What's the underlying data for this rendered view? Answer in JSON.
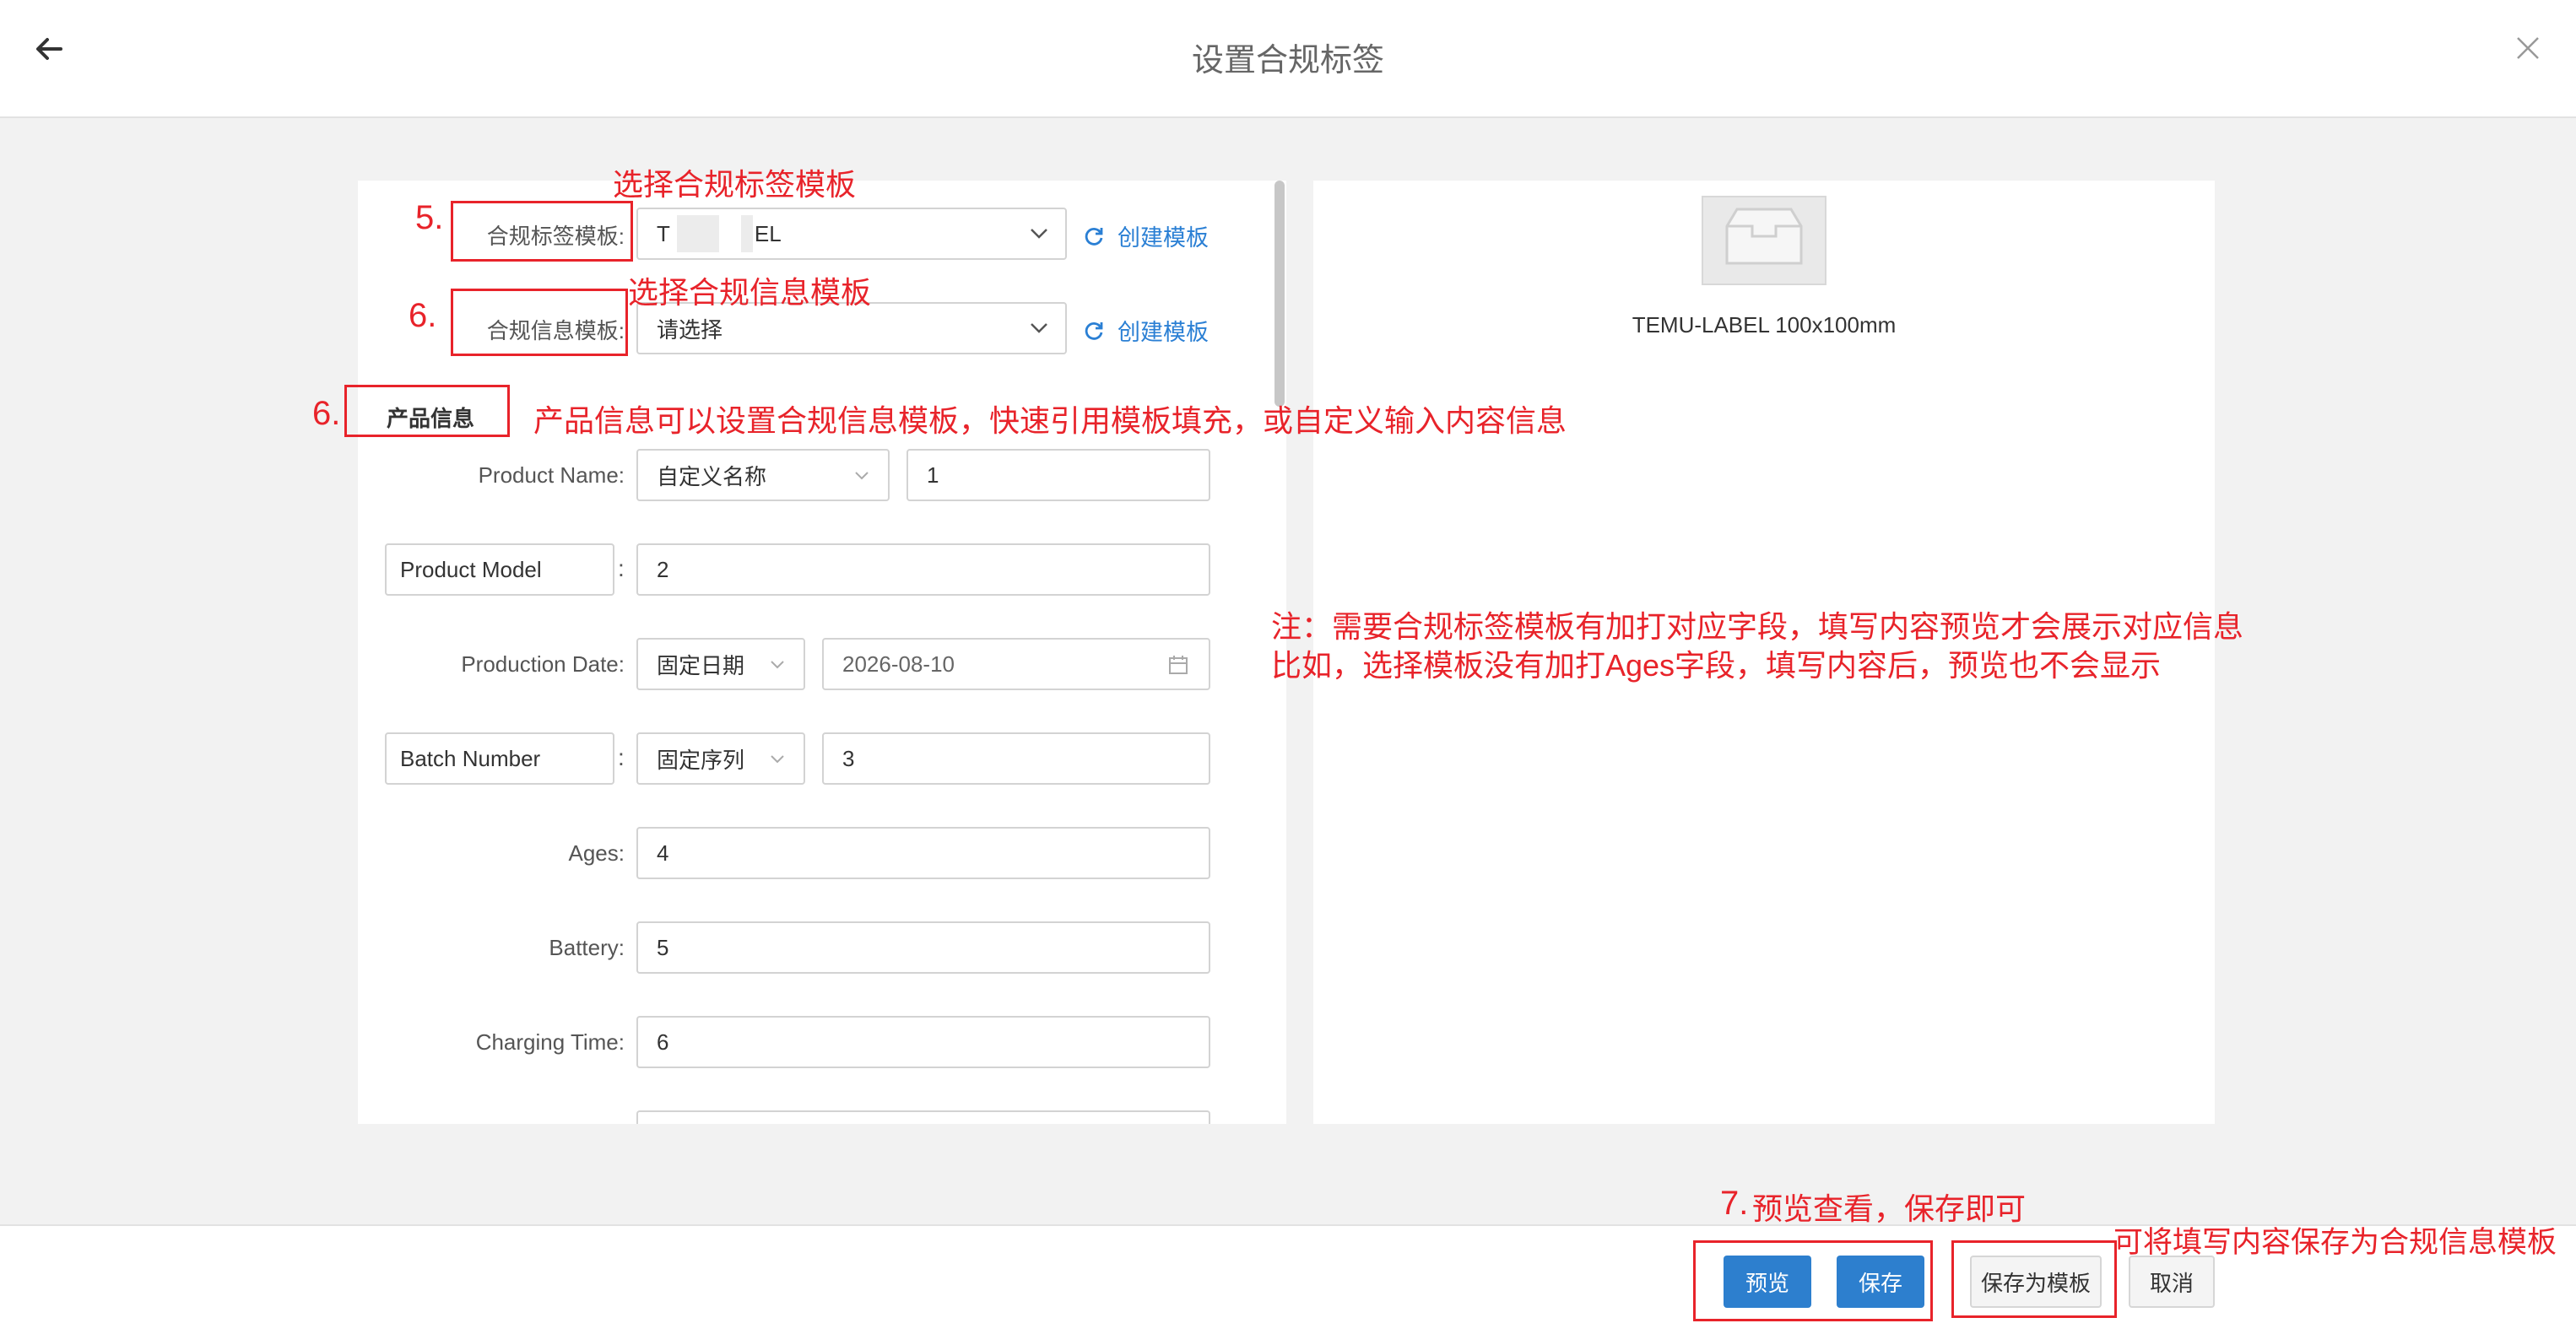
{
  "header": {
    "title": "设置合规标签"
  },
  "form": {
    "template_label": "合规标签模板:",
    "template_value_prefix": "T",
    "template_value_suffix": "EL",
    "info_template_label": "合规信息模板:",
    "info_template_placeholder": "请选择",
    "create_link": "创建模板",
    "section_tab": "产品信息",
    "fields": {
      "product_name": {
        "label": "Product Name:",
        "type": "自定义名称",
        "value": "1"
      },
      "product_model": {
        "key": "Product Model",
        "value": "2"
      },
      "production_date": {
        "label": "Production Date:",
        "type": "固定日期",
        "value": "2026-08-10"
      },
      "batch_number": {
        "key": "Batch Number",
        "type": "固定序列",
        "value": "3"
      },
      "ages": {
        "label": "Ages:",
        "value": "4"
      },
      "battery": {
        "label": "Battery:",
        "value": "5"
      },
      "charging_time": {
        "label": "Charging Time:",
        "value": "6"
      }
    }
  },
  "preview": {
    "caption": "TEMU-LABEL 100x100mm"
  },
  "footer": {
    "preview_btn": "预览",
    "save_btn": "保存",
    "save_template_btn": "保存为模板",
    "cancel_btn": "取消"
  },
  "annotations": {
    "num5": "5.",
    "num6a": "6.",
    "num6b": "6.",
    "num7": "7.",
    "note_select_label_template": "选择合规标签模板",
    "note_select_info_template": "选择合规信息模板",
    "note_product_info": "产品信息可以设置合规信息模板，快速引用模板填充，或自定义输入内容信息",
    "note_line1": "注：需要合规标签模板有加打对应字段，填写内容预览才会展示对应信息",
    "note_line2": "比如，选择模板没有加打Ages字段，填写内容后，预览也不会显示",
    "note_preview_save": "预览查看，保存即可",
    "note_save_as_template": "可将填写内容保存为合规信息模板"
  },
  "colors": {
    "primary": "#2d7fce",
    "annotation": "#e8232a",
    "link": "#2a7fd4"
  }
}
